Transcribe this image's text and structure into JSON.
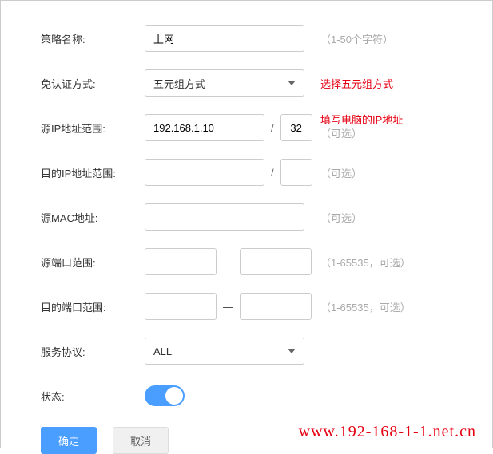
{
  "form": {
    "policyName": {
      "label": "策略名称:",
      "value": "上网",
      "hint": "（1-50个字符）"
    },
    "authMode": {
      "label": "免认证方式:",
      "value": "五元组方式",
      "annotation": "选择五元组方式"
    },
    "srcIp": {
      "label": "源IP地址范围:",
      "value": "192.168.1.10",
      "mask": "32",
      "annotationRed": "填写电脑的IP地址",
      "hint": "（可选）"
    },
    "dstIp": {
      "label": "目的IP地址范围:",
      "value": "",
      "mask": "",
      "hint": "（可选）"
    },
    "srcMac": {
      "label": "源MAC地址:",
      "value": "",
      "hint": "（可选）"
    },
    "srcPort": {
      "label": "源端口范围:",
      "from": "",
      "to": "",
      "hint": "（1-65535，可选）"
    },
    "dstPort": {
      "label": "目的端口范围:",
      "from": "",
      "to": "",
      "hint": "（1-65535，可选）"
    },
    "protocol": {
      "label": "服务协议:",
      "value": "ALL"
    },
    "status": {
      "label": "状态:"
    }
  },
  "buttons": {
    "ok": "确定",
    "cancel": "取消"
  },
  "separators": {
    "slash": "/",
    "dash": "—"
  },
  "watermark": "www.192-168-1-1.net.cn"
}
